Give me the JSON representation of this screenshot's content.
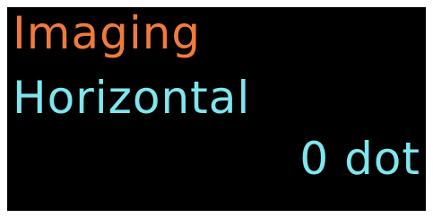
{
  "menu": {
    "title": "Imaging",
    "setting_label": "Horizontal",
    "setting_value": "0 dot"
  },
  "colors": {
    "background": "#000000",
    "frame": "#ffffff",
    "title": "#f07a3c",
    "text": "#7ee6ee"
  }
}
